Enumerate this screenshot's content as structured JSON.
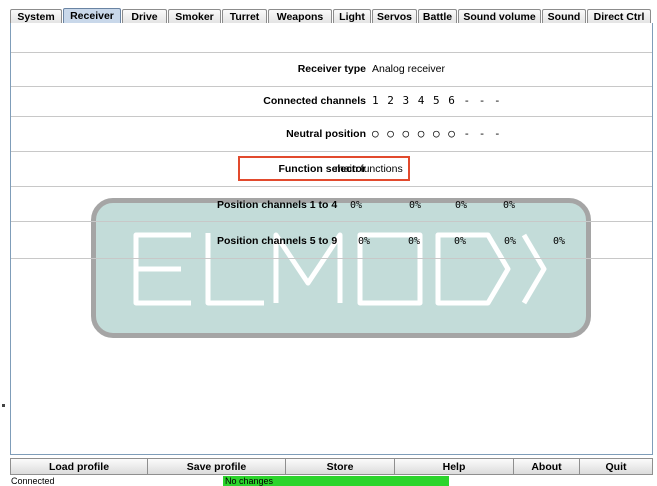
{
  "tabs": [
    {
      "label": "System",
      "active": false
    },
    {
      "label": "Receiver",
      "active": true
    },
    {
      "label": "Drive",
      "active": false
    },
    {
      "label": "Smoker",
      "active": false
    },
    {
      "label": "Turret",
      "active": false
    },
    {
      "label": "Weapons",
      "active": false
    },
    {
      "label": "Light",
      "active": false
    },
    {
      "label": "Servos",
      "active": false
    },
    {
      "label": "Battle",
      "active": false
    },
    {
      "label": "Sound volume",
      "active": false
    },
    {
      "label": "Sound",
      "active": false
    },
    {
      "label": "Direct Ctrl",
      "active": false
    }
  ],
  "receiver": {
    "type_label": "Receiver type",
    "type_value": "Analog receiver",
    "channels_label": "Connected channels",
    "channels_value": "1 2 3 4 5 6 - - -",
    "neutral_label": "Neutral position",
    "neutral_value": "○ ○ ○ ○ ○ ○ - - -",
    "function_label": "Function selector",
    "function_value": "main functions",
    "pos1_label": "Position channels 1 to 4",
    "pos1_values": [
      "0%",
      "0%",
      "0%",
      "0%"
    ],
    "pos2_label": "Position channels 5 to 9",
    "pos2_values": [
      "0%",
      "0%",
      "0%",
      "0%",
      "0%"
    ]
  },
  "watermark": {
    "text": "ELMOD"
  },
  "buttons": {
    "load": "Load profile",
    "save": "Save profile",
    "store": "Store",
    "help": "Help",
    "about": "About",
    "quit": "Quit"
  },
  "status": {
    "connection": "Connected",
    "changes": "No changes",
    "changes_color": "#2cd42c"
  }
}
